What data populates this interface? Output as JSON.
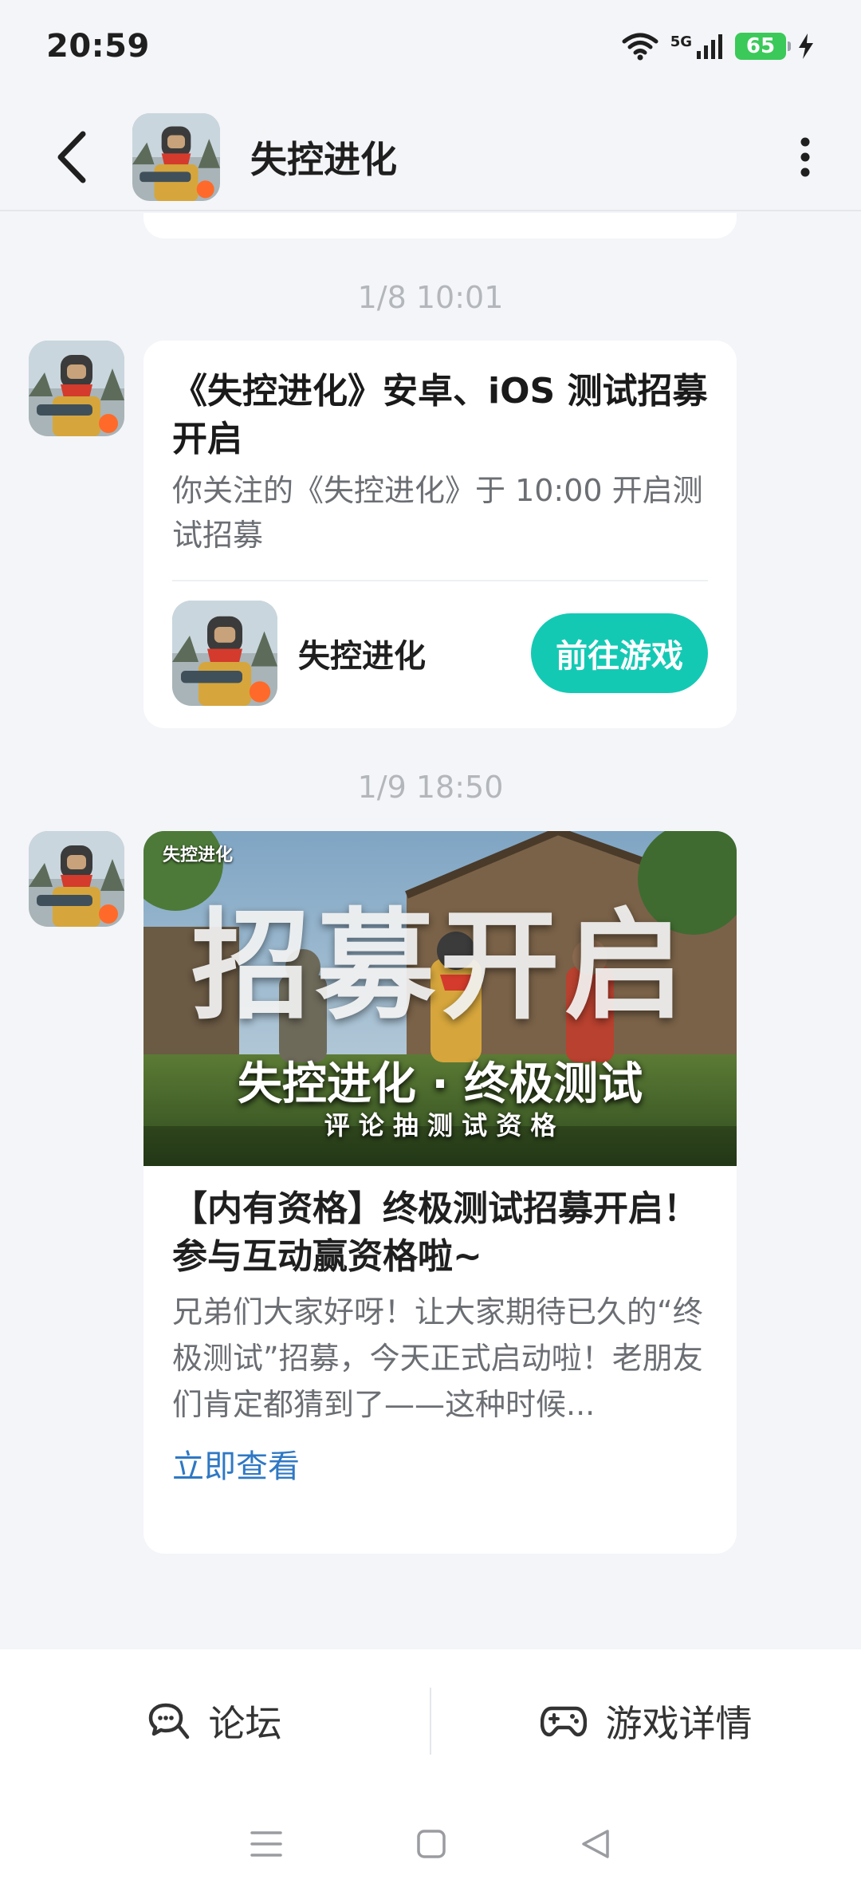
{
  "status_bar": {
    "time": "20:59",
    "network": "5G",
    "battery": "65"
  },
  "header": {
    "title": "失控进化"
  },
  "messages": [
    {
      "time": "1/8  10:01",
      "title": "《失控进化》安卓、iOS 测试招募开启",
      "desc": "你关注的《失控进化》于 10:00 开启测试招募",
      "game_name": "失控进化",
      "button": "前往游戏"
    },
    {
      "time": "1/9  18:50",
      "banner": {
        "logo": "失控进化",
        "headline": "招募开启",
        "subtitle": "失控进化 · 终极测试",
        "caption": "评 论 抽 测 试 资 格"
      },
      "title": "【内有资格】终极测试招募开启！参与互动赢资格啦~",
      "desc": "兄弟们大家好呀！让大家期待已久的“终极测试”招募，今天正式启动啦！老朋友们肯定都猜到了——这种时候...",
      "link": "立即查看"
    }
  ],
  "bottom_tabs": [
    {
      "label": "论坛",
      "icon": "chat-bubbles-icon"
    },
    {
      "label": "游戏详情",
      "icon": "gamepad-icon"
    }
  ],
  "colors": {
    "accent": "#14c9b4",
    "link": "#2f78c4",
    "battery": "#3bc95a"
  }
}
